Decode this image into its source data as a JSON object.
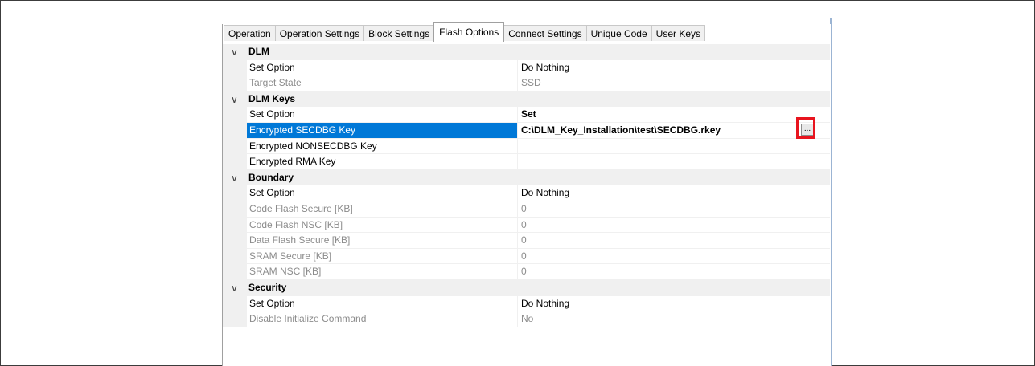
{
  "tabs": [
    {
      "label": "Operation"
    },
    {
      "label": "Operation Settings"
    },
    {
      "label": "Block Settings"
    },
    {
      "label": "Flash Options",
      "active": true
    },
    {
      "label": "Connect Settings"
    },
    {
      "label": "Unique Code"
    },
    {
      "label": "User Keys"
    }
  ],
  "grid": {
    "dlm": {
      "label": "DLM",
      "set_option": {
        "name": "Set Option",
        "value": "Do Nothing"
      },
      "target_state": {
        "name": "Target State",
        "value": "SSD"
      }
    },
    "dlm_keys": {
      "label": "DLM Keys",
      "set_option": {
        "name": "Set Option",
        "value": "Set"
      },
      "secdbg": {
        "name": "Encrypted SECDBG Key",
        "value": "C:\\DLM_Key_Installation\\test\\SECDBG.rkey"
      },
      "nonsecdbg": {
        "name": "Encrypted NONSECDBG Key",
        "value": ""
      },
      "rma": {
        "name": "Encrypted RMA Key",
        "value": ""
      }
    },
    "boundary": {
      "label": "Boundary",
      "set_option": {
        "name": "Set Option",
        "value": "Do Nothing"
      },
      "code_flash_secure": {
        "name": "Code Flash Secure [KB]",
        "value": "0"
      },
      "code_flash_nsc": {
        "name": "Code Flash NSC [KB]",
        "value": "0"
      },
      "data_flash_secure": {
        "name": "Data Flash Secure [KB]",
        "value": "0"
      },
      "sram_secure": {
        "name": "SRAM Secure [KB]",
        "value": "0"
      },
      "sram_nsc": {
        "name": "SRAM NSC [KB]",
        "value": "0"
      }
    },
    "security": {
      "label": "Security",
      "set_option": {
        "name": "Set Option",
        "value": "Do Nothing"
      },
      "disable_init": {
        "name": "Disable Initialize Command",
        "value": "No"
      }
    }
  },
  "browse_button": {
    "label": "..."
  },
  "icons": {
    "expander": "chevron-down-icon"
  },
  "colors": {
    "selection": "#0078d7",
    "highlight_box": "#e8141e"
  }
}
